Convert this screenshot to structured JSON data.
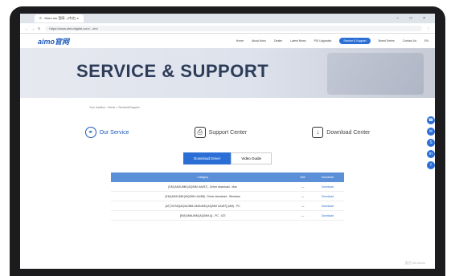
{
  "browser": {
    "tab_title": "© - Kimo mo 官网 - (中文) x",
    "url": "https://www.aimodigital.com/.../en/",
    "window_controls": "− □ ×"
  },
  "header": {
    "logo": "aimo官网",
    "nav": [
      "Home",
      "About Aimo",
      "Dealer",
      "Latest News",
      "PSI Upgrades",
      "Service & Support",
      "Brand Series",
      "Contact Us",
      "EN"
    ]
  },
  "banner": {
    "title": "SERVICE & SUPPORT"
  },
  "breadcrumb": "Your location : Home > Service&Support",
  "services": [
    "Our Service",
    "Support Center",
    "Download Center"
  ],
  "toggle": [
    "Download Driver",
    "Video Guide"
  ],
  "table": {
    "headers": [
      "Category",
      "Size",
      "Download"
    ],
    "rows": [
      [
        "[DM] AM2UMM [AQ/MM UAI/87] - Driver download - Mac",
        "—",
        "Download"
      ],
      [
        "[EM] AM2UMM [MQ/MM UAI/88] - Driver download - Windows",
        "—",
        "Download"
      ],
      [
        "[AT] SOTAQAQ/AUMM-AM2UMM [AQ/MM UAI/87] (MM) - PC",
        "—",
        "Download"
      ],
      [
        "[EM] AM4UMM [AQ/MM-A] - PC - ICE",
        "—",
        "Download"
      ]
    ]
  },
  "side_icons": [
    "chat-icon",
    "wechat-icon",
    "skype-icon",
    "linkedin-icon",
    "facebook-icon"
  ],
  "watermark": "激活 Windows"
}
